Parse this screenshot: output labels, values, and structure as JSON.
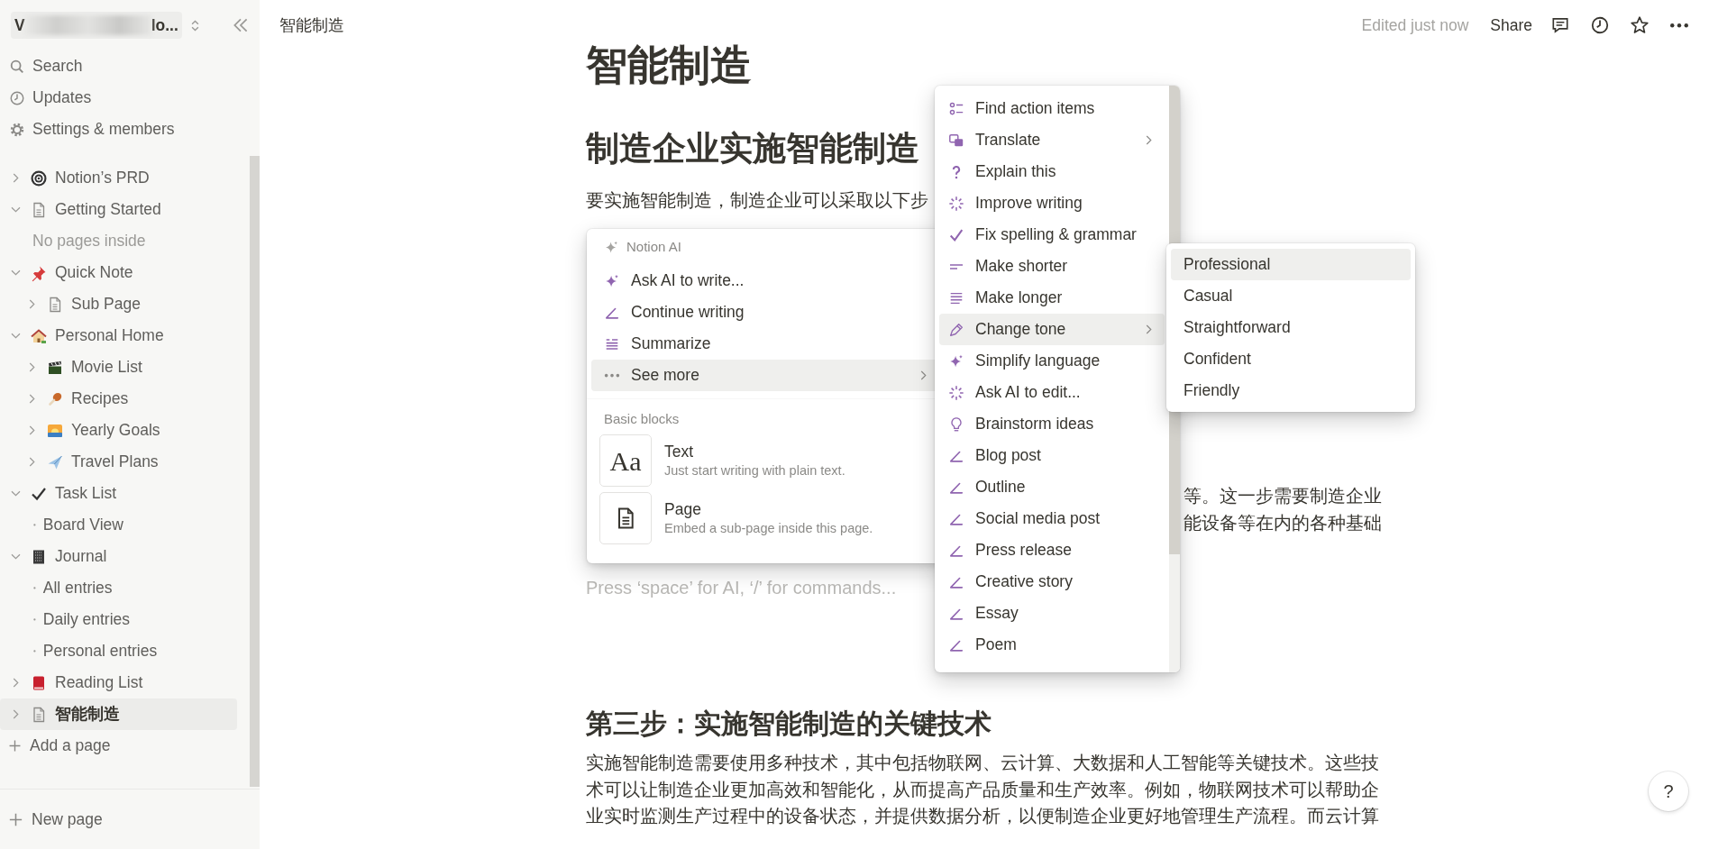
{
  "sidebar": {
    "workspace": {
      "name_start": "V",
      "name_end": "lo..."
    },
    "nav": [
      {
        "label": "Search"
      },
      {
        "label": "Updates"
      },
      {
        "label": "Settings & members"
      }
    ],
    "tree": [
      {
        "kind": "page",
        "label": "Notion’s PRD",
        "expanded": false,
        "selected": false
      },
      {
        "kind": "page",
        "label": "Getting Started",
        "expanded": true,
        "selected": false,
        "children": [
          {
            "kind": "empty",
            "label": "No pages inside"
          }
        ]
      },
      {
        "kind": "page",
        "label": "Quick Note",
        "expanded": true,
        "selected": false,
        "children": [
          {
            "kind": "page",
            "label": "Sub Page",
            "expanded": false,
            "selected": false
          }
        ]
      },
      {
        "kind": "page",
        "label": "Personal Home",
        "expanded": true,
        "selected": false,
        "children": [
          {
            "kind": "page",
            "label": "Movie List",
            "expanded": false,
            "selected": false
          },
          {
            "kind": "page",
            "label": "Recipes",
            "expanded": false,
            "selected": false
          },
          {
            "kind": "page",
            "label": "Yearly Goals",
            "expanded": false,
            "selected": false
          },
          {
            "kind": "page",
            "label": "Travel Plans",
            "expanded": false,
            "selected": false
          }
        ]
      },
      {
        "kind": "page",
        "label": "Task List",
        "expanded": true,
        "selected": false,
        "children": [
          {
            "kind": "view",
            "label": "Board View",
            "selected": false
          }
        ]
      },
      {
        "kind": "page",
        "label": "Journal",
        "expanded": true,
        "selected": false,
        "children": [
          {
            "kind": "view",
            "label": "All entries",
            "selected": false
          },
          {
            "kind": "view",
            "label": "Daily entries",
            "selected": false
          },
          {
            "kind": "view",
            "label": "Personal entries",
            "selected": false
          }
        ]
      },
      {
        "kind": "page",
        "label": "Reading List",
        "expanded": false,
        "selected": false
      },
      {
        "kind": "page",
        "label": "智能制造",
        "expanded": false,
        "selected": true
      }
    ],
    "add_page": "Add a page",
    "new_page": "New page"
  },
  "topbar": {
    "breadcrumb": "智能制造",
    "edited": "Edited just now",
    "share": "Share"
  },
  "document": {
    "title": "智能制造",
    "heading": "制造企业实施智能制造",
    "intro": "要实施智能制造，制造企业可以采取以下步",
    "fragment_lines": [
      "等。这一步需要制造企业",
      "能设备等在内的各种基础"
    ],
    "placeholder": "Press ‘space’ for AI, ‘/’ for commands...",
    "section_heading": "第三步：实施智能制造的关键技术",
    "section_body": "实施智能制造需要使用多种技术，其中包括物联网、云计算、大数据和人工智能等关键技术。这些技术可以让制造企业更加高效和智能化，从而提高产品质量和生产效率。例如，物联网技术可以帮助企业实时监测生产过程中的设备状态，并提供数据分析，以便制造企业更好地管理生产流程。而云计算"
  },
  "ai_menu": {
    "header": "Notion AI",
    "items": [
      {
        "label": "Ask AI to write...",
        "has_submenu": false,
        "selected": false
      },
      {
        "label": "Continue writing",
        "has_submenu": false,
        "selected": false
      },
      {
        "label": "Summarize",
        "has_submenu": false,
        "selected": false
      },
      {
        "label": "See more",
        "has_submenu": true,
        "selected": true
      }
    ],
    "section": "Basic blocks",
    "blocks": [
      {
        "icon_text": "Aa",
        "title": "Text",
        "description": "Just start writing with plain text."
      },
      {
        "title": "Page",
        "description": "Embed a sub-page inside this page."
      }
    ]
  },
  "actions_menu": {
    "items": [
      {
        "label": "Find action items",
        "has_submenu": false,
        "selected": false
      },
      {
        "label": "Translate",
        "has_submenu": true,
        "selected": false
      },
      {
        "label": "Explain this",
        "has_submenu": false,
        "selected": false
      },
      {
        "label": "Improve writing",
        "has_submenu": false,
        "selected": false
      },
      {
        "label": "Fix spelling & grammar",
        "has_submenu": false,
        "selected": false
      },
      {
        "label": "Make shorter",
        "has_submenu": false,
        "selected": false
      },
      {
        "label": "Make longer",
        "has_submenu": false,
        "selected": false
      },
      {
        "label": "Change tone",
        "has_submenu": true,
        "selected": true
      },
      {
        "label": "Simplify language",
        "has_submenu": false,
        "selected": false
      },
      {
        "label": "Ask AI to edit...",
        "has_submenu": false,
        "selected": false
      },
      {
        "label": "Brainstorm ideas",
        "has_submenu": false,
        "selected": false
      },
      {
        "label": "Blog post",
        "has_submenu": false,
        "selected": false
      },
      {
        "label": "Outline",
        "has_submenu": false,
        "selected": false
      },
      {
        "label": "Social media post",
        "has_submenu": false,
        "selected": false
      },
      {
        "label": "Press release",
        "has_submenu": false,
        "selected": false
      },
      {
        "label": "Creative story",
        "has_submenu": false,
        "selected": false
      },
      {
        "label": "Essay",
        "has_submenu": false,
        "selected": false
      },
      {
        "label": "Poem",
        "has_submenu": false,
        "selected": false
      }
    ]
  },
  "tone_menu": {
    "items": [
      {
        "label": "Professional",
        "selected": true
      },
      {
        "label": "Casual",
        "selected": false
      },
      {
        "label": "Straightforward",
        "selected": false
      },
      {
        "label": "Confident",
        "selected": false
      },
      {
        "label": "Friendly",
        "selected": false
      }
    ]
  },
  "help": "?"
}
